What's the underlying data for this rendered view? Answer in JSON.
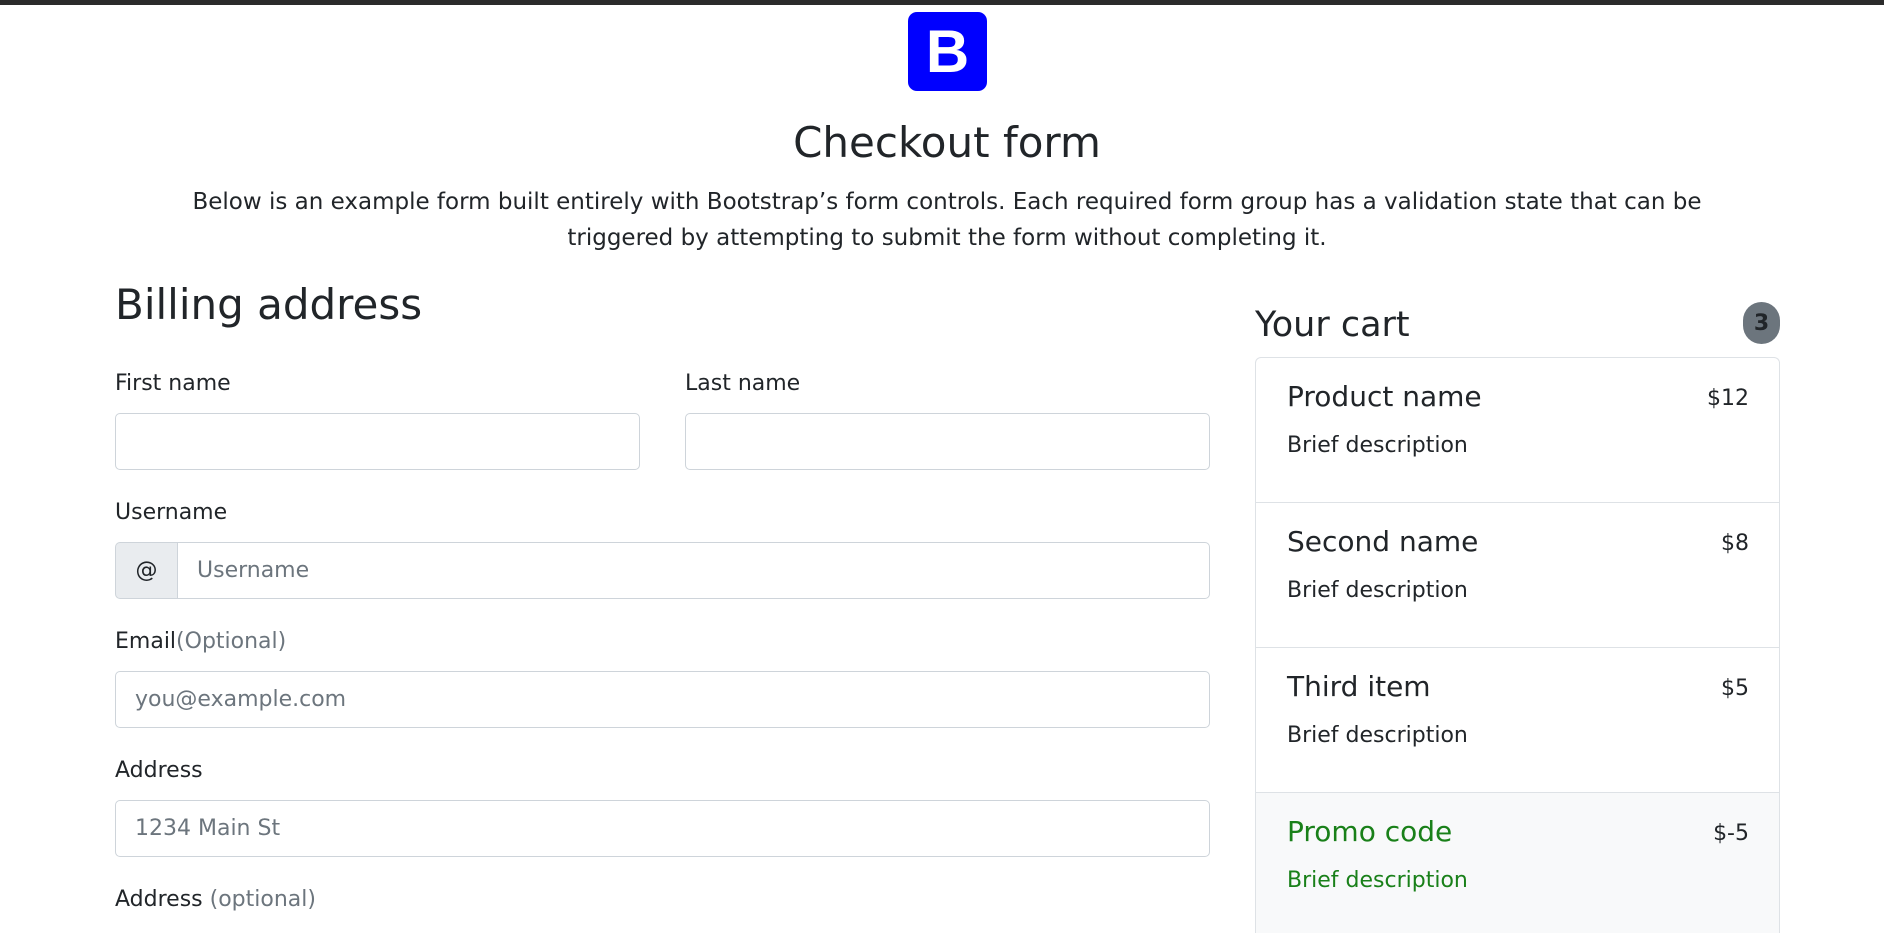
{
  "header": {
    "logo_letter": "B",
    "title": "Checkout form",
    "lead": "Below is an example form built entirely with Bootstrap’s form controls. Each required form group has a validation state that can be triggered by attempting to submit the form without completing it."
  },
  "billing": {
    "title": "Billing address",
    "first_name": {
      "label": "First name",
      "value": "",
      "placeholder": ""
    },
    "last_name": {
      "label": "Last name",
      "value": "",
      "placeholder": ""
    },
    "username": {
      "label": "Username",
      "prefix": "@",
      "value": "",
      "placeholder": "Username"
    },
    "email": {
      "label": "Email",
      "optional": "(Optional)",
      "value": "",
      "placeholder": "you@example.com"
    },
    "address": {
      "label": "Address",
      "value": "",
      "placeholder": "1234 Main St"
    },
    "address2": {
      "label": "Address",
      "optional": " (optional)"
    }
  },
  "cart": {
    "title": "Your cart",
    "count": "3",
    "items": [
      {
        "name": "Product name",
        "description": "Brief description",
        "price": "$12"
      },
      {
        "name": "Second name",
        "description": "Brief description",
        "price": "$8"
      },
      {
        "name": "Third item",
        "description": "Brief description",
        "price": "$5"
      },
      {
        "name": "Promo code",
        "description": "Brief description",
        "price": "$-5"
      }
    ]
  },
  "colors": {
    "brand": "#0000ff",
    "promo": "#198019",
    "badge": "#6c757d"
  }
}
